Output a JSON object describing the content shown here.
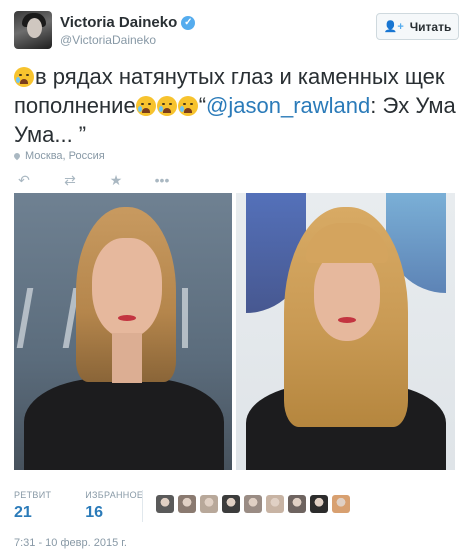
{
  "author": {
    "name": "Victoria Daineko",
    "handle": "@VictoriaDaineko",
    "verified_icon": "verified-badge-icon"
  },
  "follow_button": {
    "label": "Читать",
    "icon": "follow-user-icon"
  },
  "tweet": {
    "text_part1": "в рядах натянутых глаз и каменных щек пополнение",
    "text_quote_open": "“",
    "mention": "@jason_rawland",
    "text_part2": ": Эх Ума Ума... ”",
    "emoji": "crying-face"
  },
  "location": {
    "label": "Москва, Россия",
    "icon": "location-pin-icon"
  },
  "actions": [
    {
      "name": "reply",
      "icon": "↶"
    },
    {
      "name": "retweet",
      "icon": "⇄"
    },
    {
      "name": "favorite",
      "icon": "★"
    },
    {
      "name": "more",
      "icon": "•••"
    }
  ],
  "stats": {
    "retweets_label": "РЕТВИТ",
    "retweets_value": "21",
    "favorites_label": "ИЗБРАННОЕ",
    "favorites_value": "16"
  },
  "likers": [
    {
      "color": "#5a5a5a"
    },
    {
      "color": "#8a7a70"
    },
    {
      "color": "#b8a89a"
    },
    {
      "color": "#3c3c3c"
    },
    {
      "color": "#9a8c84"
    },
    {
      "color": "#c8b4a4"
    },
    {
      "color": "#6e6460"
    },
    {
      "color": "#2c2c2c"
    },
    {
      "color": "#d8a070"
    }
  ],
  "timestamp": "7:31 - 10 февр. 2015 г.",
  "colors": {
    "link": "#2b7bb9",
    "muted": "#8899a6",
    "text": "#292f33",
    "accent": "#55acee"
  }
}
